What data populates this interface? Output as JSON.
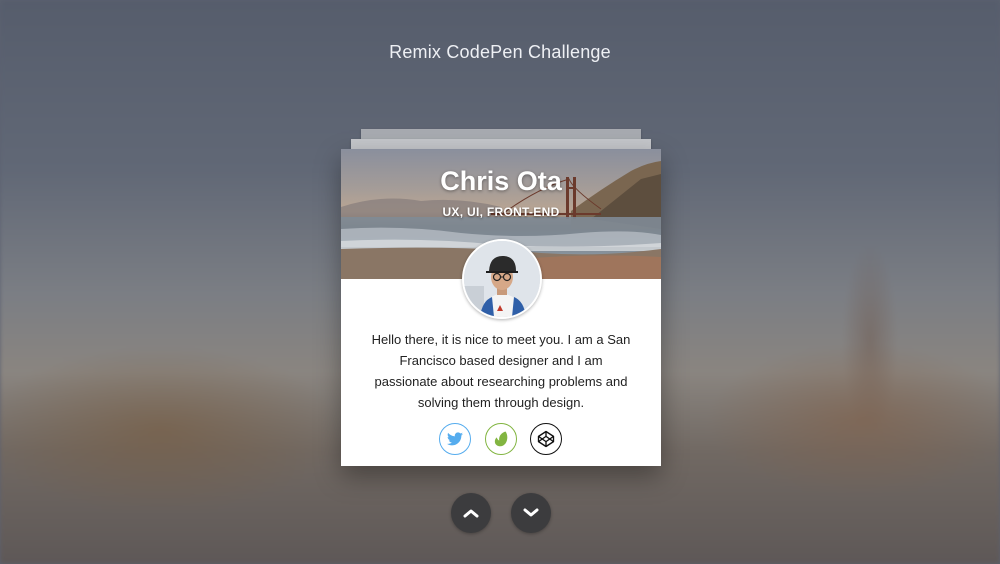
{
  "page": {
    "title": "Remix CodePen Challenge"
  },
  "card": {
    "name": "Chris Ota",
    "role": "UX, UI, FRONT-END",
    "bio": "Hello there, it is nice to meet you. I am a San Francisco based designer and I am passionate about researching problems and solving them through design.",
    "socials": [
      {
        "icon": "twitter-icon",
        "color": "#55acee"
      },
      {
        "icon": "envato-icon",
        "color": "#82b541"
      },
      {
        "icon": "codepen-icon",
        "color": "#111111"
      }
    ]
  },
  "navigation": {
    "up_icon": "chevron-up-icon",
    "down_icon": "chevron-down-icon"
  }
}
